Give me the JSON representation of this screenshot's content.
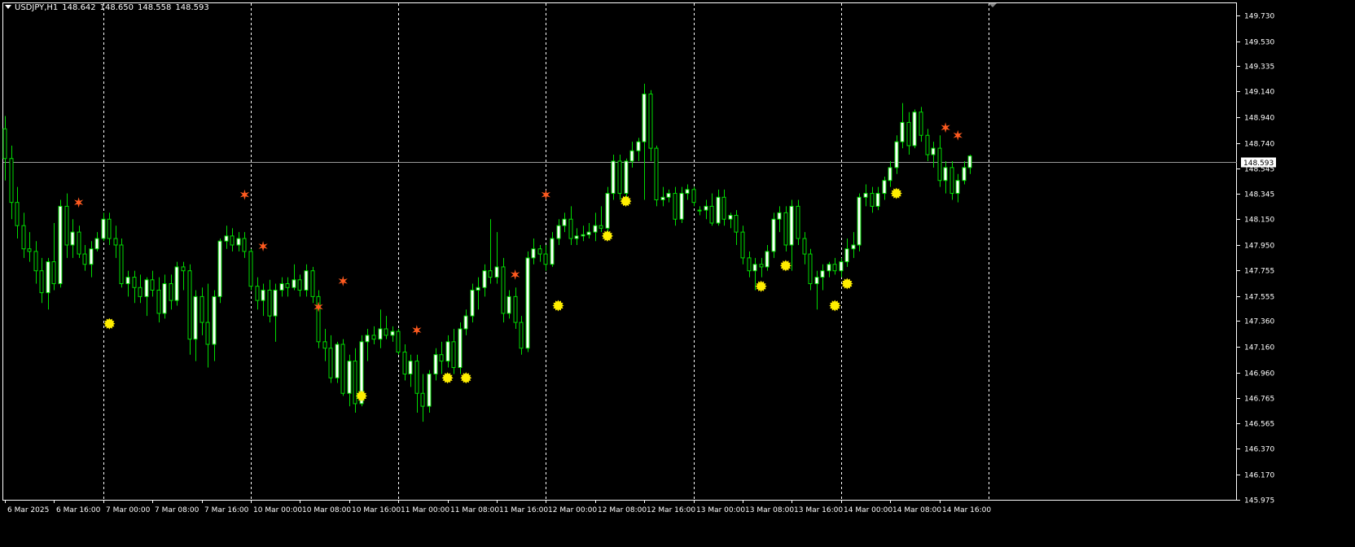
{
  "header": {
    "symbol": "USDJPY,H1",
    "open": "148.642",
    "high": "148.650",
    "low": "148.558",
    "close": "148.593"
  },
  "colors": {
    "background": "#000000",
    "grid": "#ffffff",
    "candle_up_body": "#ffffff",
    "candle_outline": "#00dd00",
    "buy_signal": "#ffee00",
    "sell_signal": "#ff5a1f",
    "bid_line": "#9a9a9a"
  },
  "icons": {
    "buy_signal": "sun-marker-icon",
    "sell_signal": "star-marker-icon"
  },
  "chart_data": {
    "type": "candlestick",
    "symbol": "USDJPY",
    "timeframe": "H1",
    "ylim": [
      145.975,
      149.83
    ],
    "y_ticks": [
      "149.730",
      "149.530",
      "149.335",
      "149.140",
      "148.940",
      "148.740",
      "148.545",
      "148.345",
      "148.150",
      "147.950",
      "147.755",
      "147.555",
      "147.360",
      "147.160",
      "146.960",
      "146.765",
      "146.565",
      "146.370",
      "146.170",
      "145.975"
    ],
    "current_price": "148.593",
    "x_labels": [
      "6 Mar 2025",
      "6 Mar 16:00",
      "7 Mar 00:00",
      "7 Mar 08:00",
      "7 Mar 16:00",
      "10 Mar 00:00",
      "10 Mar 08:00",
      "10 Mar 16:00",
      "11 Mar 00:00",
      "11 Mar 08:00",
      "11 Mar 16:00",
      "12 Mar 00:00",
      "12 Mar 08:00",
      "12 Mar 16:00",
      "13 Mar 00:00",
      "13 Mar 08:00",
      "13 Mar 16:00",
      "14 Mar 00:00",
      "14 Mar 08:00",
      "14 Mar 16:00"
    ],
    "x_label_index": [
      0,
      8,
      16,
      24,
      32,
      40,
      48,
      56,
      64,
      72,
      80,
      88,
      96,
      104,
      112,
      120,
      128,
      136,
      144,
      152
    ],
    "day_separator_index": [
      16,
      40,
      64,
      88,
      112,
      136,
      160
    ],
    "candles": [
      [
        148.85,
        148.95,
        148.45,
        148.62
      ],
      [
        148.62,
        148.72,
        148.15,
        148.28
      ],
      [
        148.28,
        148.4,
        148.0,
        148.1
      ],
      [
        148.1,
        148.2,
        147.85,
        147.92
      ],
      [
        147.92,
        148.05,
        147.82,
        147.9
      ],
      [
        147.9,
        147.98,
        147.65,
        147.75
      ],
      [
        147.75,
        147.85,
        147.5,
        147.58
      ],
      [
        147.58,
        147.85,
        147.45,
        147.82
      ],
      [
        147.82,
        148.12,
        147.6,
        147.65
      ],
      [
        147.65,
        148.3,
        147.62,
        148.25
      ],
      [
        148.25,
        148.35,
        147.85,
        147.95
      ],
      [
        147.95,
        148.15,
        147.85,
        148.05
      ],
      [
        148.05,
        148.1,
        147.85,
        147.88
      ],
      [
        147.88,
        147.95,
        147.75,
        147.8
      ],
      [
        147.8,
        147.98,
        147.7,
        147.92
      ],
      [
        147.92,
        148.05,
        147.9,
        148.0
      ],
      [
        148.0,
        148.2,
        147.98,
        148.15
      ],
      [
        148.15,
        148.2,
        147.95,
        148.0
      ],
      [
        148.0,
        148.1,
        147.85,
        147.95
      ],
      [
        147.95,
        148.0,
        147.62,
        147.65
      ],
      [
        147.65,
        147.75,
        147.55,
        147.7
      ],
      [
        147.7,
        147.75,
        147.5,
        147.62
      ],
      [
        147.62,
        147.72,
        147.5,
        147.55
      ],
      [
        147.55,
        147.7,
        147.4,
        147.68
      ],
      [
        147.68,
        147.75,
        147.55,
        147.6
      ],
      [
        147.6,
        147.7,
        147.35,
        147.42
      ],
      [
        147.42,
        147.72,
        147.38,
        147.65
      ],
      [
        147.65,
        147.72,
        147.45,
        147.52
      ],
      [
        147.52,
        147.82,
        147.48,
        147.78
      ],
      [
        147.78,
        147.82,
        147.6,
        147.75
      ],
      [
        147.75,
        147.8,
        147.1,
        147.22
      ],
      [
        147.22,
        147.6,
        147.05,
        147.55
      ],
      [
        147.55,
        147.62,
        147.25,
        147.35
      ],
      [
        147.35,
        147.65,
        147.0,
        147.18
      ],
      [
        147.18,
        147.6,
        147.05,
        147.55
      ],
      [
        147.55,
        148.0,
        147.5,
        147.98
      ],
      [
        147.98,
        148.1,
        147.92,
        148.02
      ],
      [
        148.02,
        148.08,
        147.9,
        147.95
      ],
      [
        147.95,
        148.05,
        147.9,
        148.0
      ],
      [
        148.0,
        148.05,
        147.85,
        147.9
      ],
      [
        147.9,
        147.92,
        147.6,
        147.63
      ],
      [
        147.63,
        147.7,
        147.45,
        147.52
      ],
      [
        147.52,
        147.65,
        147.4,
        147.6
      ],
      [
        147.6,
        147.68,
        147.35,
        147.4
      ],
      [
        147.4,
        147.65,
        147.2,
        147.6
      ],
      [
        147.6,
        147.7,
        147.55,
        147.65
      ],
      [
        147.65,
        147.7,
        147.55,
        147.62
      ],
      [
        147.62,
        147.8,
        147.6,
        147.68
      ],
      [
        147.68,
        147.72,
        147.55,
        147.6
      ],
      [
        147.6,
        147.8,
        147.55,
        147.75
      ],
      [
        147.75,
        147.78,
        147.5,
        147.55
      ],
      [
        147.55,
        147.6,
        147.15,
        147.2
      ],
      [
        147.2,
        147.3,
        147.05,
        147.15
      ],
      [
        147.15,
        147.25,
        146.88,
        146.92
      ],
      [
        146.92,
        147.2,
        146.88,
        147.18
      ],
      [
        147.18,
        147.22,
        146.78,
        146.8
      ],
      [
        146.8,
        147.1,
        146.7,
        147.05
      ],
      [
        147.05,
        147.15,
        146.65,
        146.72
      ],
      [
        146.72,
        147.25,
        146.7,
        147.2
      ],
      [
        147.2,
        147.3,
        147.05,
        147.25
      ],
      [
        147.25,
        147.32,
        147.18,
        147.22
      ],
      [
        147.22,
        147.45,
        147.15,
        147.3
      ],
      [
        147.3,
        147.4,
        147.22,
        147.25
      ],
      [
        147.25,
        147.32,
        147.2,
        147.28
      ],
      [
        147.28,
        147.3,
        147.1,
        147.12
      ],
      [
        147.12,
        147.18,
        146.9,
        146.95
      ],
      [
        146.95,
        147.1,
        146.85,
        147.05
      ],
      [
        147.05,
        147.1,
        146.65,
        146.8
      ],
      [
        146.8,
        146.95,
        146.58,
        146.7
      ],
      [
        146.7,
        146.98,
        146.65,
        146.95
      ],
      [
        146.95,
        147.15,
        146.9,
        147.1
      ],
      [
        147.1,
        147.2,
        146.95,
        147.05
      ],
      [
        147.05,
        147.25,
        147.0,
        147.2
      ],
      [
        147.2,
        147.3,
        146.95,
        147.0
      ],
      [
        147.0,
        147.35,
        146.95,
        147.3
      ],
      [
        147.3,
        147.45,
        147.25,
        147.4
      ],
      [
        147.4,
        147.65,
        147.35,
        147.6
      ],
      [
        147.6,
        147.7,
        147.45,
        147.62
      ],
      [
        147.62,
        147.8,
        147.55,
        147.75
      ],
      [
        147.75,
        148.15,
        147.65,
        147.7
      ],
      [
        147.7,
        148.05,
        147.65,
        147.78
      ],
      [
        147.78,
        147.85,
        147.35,
        147.42
      ],
      [
        147.42,
        147.6,
        147.38,
        147.55
      ],
      [
        147.55,
        147.62,
        147.3,
        147.35
      ],
      [
        147.35,
        147.4,
        147.1,
        147.15
      ],
      [
        147.15,
        147.9,
        147.12,
        147.85
      ],
      [
        147.85,
        148.0,
        147.8,
        147.92
      ],
      [
        147.92,
        147.95,
        147.82,
        147.88
      ],
      [
        147.88,
        147.95,
        147.75,
        147.8
      ],
      [
        147.8,
        148.05,
        147.78,
        148.0
      ],
      [
        148.0,
        148.15,
        147.95,
        148.1
      ],
      [
        148.1,
        148.2,
        148.05,
        148.15
      ],
      [
        148.15,
        148.25,
        147.95,
        148.0
      ],
      [
        148.0,
        148.08,
        147.95,
        148.02
      ],
      [
        148.02,
        148.1,
        147.98,
        148.03
      ],
      [
        148.03,
        148.12,
        148.0,
        148.05
      ],
      [
        148.05,
        148.2,
        147.98,
        148.1
      ],
      [
        148.1,
        148.25,
        148.05,
        148.08
      ],
      [
        148.08,
        148.4,
        148.0,
        148.35
      ],
      [
        148.35,
        148.65,
        148.3,
        148.6
      ],
      [
        148.6,
        148.65,
        148.3,
        148.35
      ],
      [
        148.35,
        148.62,
        148.32,
        148.6
      ],
      [
        148.6,
        148.75,
        148.55,
        148.68
      ],
      [
        148.68,
        148.78,
        148.6,
        148.75
      ],
      [
        148.75,
        149.2,
        148.3,
        149.12
      ],
      [
        149.12,
        149.15,
        148.6,
        148.7
      ],
      [
        148.7,
        148.72,
        148.25,
        148.3
      ],
      [
        148.3,
        148.4,
        148.25,
        148.32
      ],
      [
        148.32,
        148.38,
        148.28,
        148.35
      ],
      [
        148.35,
        148.4,
        148.1,
        148.15
      ],
      [
        148.15,
        148.4,
        148.12,
        148.35
      ],
      [
        148.35,
        148.42,
        148.3,
        148.38
      ],
      [
        148.38,
        148.4,
        148.25,
        148.28
      ],
      [
        148.22,
        148.25,
        148.18,
        148.22
      ],
      [
        148.22,
        148.3,
        148.15,
        148.25
      ],
      [
        148.25,
        148.35,
        148.1,
        148.12
      ],
      [
        148.12,
        148.38,
        148.1,
        148.32
      ],
      [
        148.32,
        148.38,
        148.1,
        148.15
      ],
      [
        148.15,
        148.2,
        148.08,
        148.18
      ],
      [
        148.18,
        148.22,
        147.95,
        148.05
      ],
      [
        148.05,
        148.1,
        147.8,
        147.85
      ],
      [
        147.85,
        147.9,
        147.7,
        147.75
      ],
      [
        147.75,
        147.85,
        147.6,
        147.8
      ],
      [
        147.8,
        147.85,
        147.7,
        147.78
      ],
      [
        147.78,
        147.95,
        147.75,
        147.9
      ],
      [
        147.9,
        148.2,
        147.85,
        148.15
      ],
      [
        148.15,
        148.25,
        148.05,
        148.2
      ],
      [
        148.2,
        148.25,
        147.9,
        147.95
      ],
      [
        147.95,
        148.3,
        147.75,
        148.25
      ],
      [
        148.25,
        148.3,
        147.95,
        148.0
      ],
      [
        148.0,
        148.05,
        147.8,
        147.88
      ],
      [
        147.88,
        147.92,
        147.6,
        147.65
      ],
      [
        147.65,
        147.75,
        147.45,
        147.7
      ],
      [
        147.7,
        147.8,
        147.6,
        147.75
      ],
      [
        147.75,
        147.82,
        147.7,
        147.8
      ],
      [
        147.8,
        147.85,
        147.72,
        147.75
      ],
      [
        147.75,
        147.85,
        147.7,
        147.82
      ],
      [
        147.82,
        148.0,
        147.78,
        147.92
      ],
      [
        147.92,
        148.05,
        147.85,
        147.95
      ],
      [
        147.95,
        148.35,
        147.9,
        148.32
      ],
      [
        148.32,
        148.42,
        148.25,
        148.35
      ],
      [
        148.35,
        148.4,
        148.2,
        148.25
      ],
      [
        148.25,
        148.4,
        148.22,
        148.35
      ],
      [
        148.35,
        148.48,
        148.3,
        148.45
      ],
      [
        148.45,
        148.6,
        148.4,
        148.55
      ],
      [
        148.55,
        148.8,
        148.5,
        148.75
      ],
      [
        148.75,
        149.05,
        148.7,
        148.9
      ],
      [
        148.9,
        148.98,
        148.65,
        148.72
      ],
      [
        148.72,
        149.0,
        148.7,
        148.98
      ],
      [
        148.98,
        149.02,
        148.75,
        148.8
      ],
      [
        148.8,
        148.85,
        148.6,
        148.65
      ],
      [
        148.65,
        148.75,
        148.55,
        148.7
      ],
      [
        148.7,
        148.8,
        148.4,
        148.45
      ],
      [
        148.45,
        148.6,
        148.35,
        148.55
      ],
      [
        148.55,
        148.6,
        148.3,
        148.35
      ],
      [
        148.35,
        148.5,
        148.28,
        148.45
      ],
      [
        148.45,
        148.6,
        148.42,
        148.55
      ],
      [
        148.55,
        148.65,
        148.5,
        148.64
      ]
    ],
    "buy_signals": [
      [
        17,
        147.34
      ],
      [
        58,
        146.78
      ],
      [
        72,
        146.92
      ],
      [
        75,
        146.92
      ],
      [
        90,
        147.48
      ],
      [
        98,
        148.02
      ],
      [
        101,
        148.29
      ],
      [
        123,
        147.63
      ],
      [
        127,
        147.79
      ],
      [
        135,
        147.48
      ],
      [
        137,
        147.65
      ],
      [
        145,
        148.35
      ]
    ],
    "sell_signals": [
      [
        12,
        148.28
      ],
      [
        39,
        148.34
      ],
      [
        42,
        147.94
      ],
      [
        51,
        147.47
      ],
      [
        55,
        147.67
      ],
      [
        67,
        147.29
      ],
      [
        83,
        147.72
      ],
      [
        88,
        148.34
      ],
      [
        153,
        148.86
      ],
      [
        155,
        148.8
      ]
    ]
  }
}
